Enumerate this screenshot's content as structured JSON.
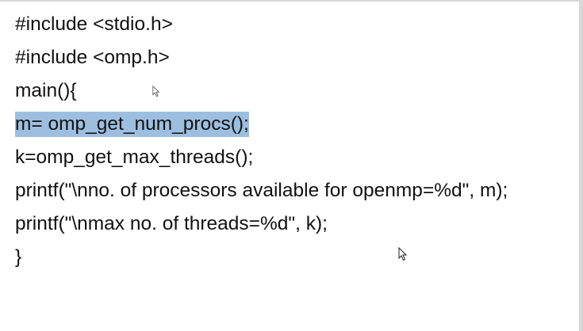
{
  "code": {
    "lines": [
      "#include <stdio.h>",
      "#include <omp.h>",
      "main(){",
      "m= omp_get_num_procs();",
      "k=omp_get_max_threads();",
      "printf(\"\\nno. of processors available for openmp=%d\", m);",
      "printf(\"\\nmax no. of threads=%d\", k);",
      "}"
    ],
    "highlighted_line": 3,
    "highlight_color": "#9dbfdf"
  },
  "icons": {
    "pointer_1": "mouse-pointer-icon",
    "pointer_2": "mouse-pointer-icon"
  }
}
